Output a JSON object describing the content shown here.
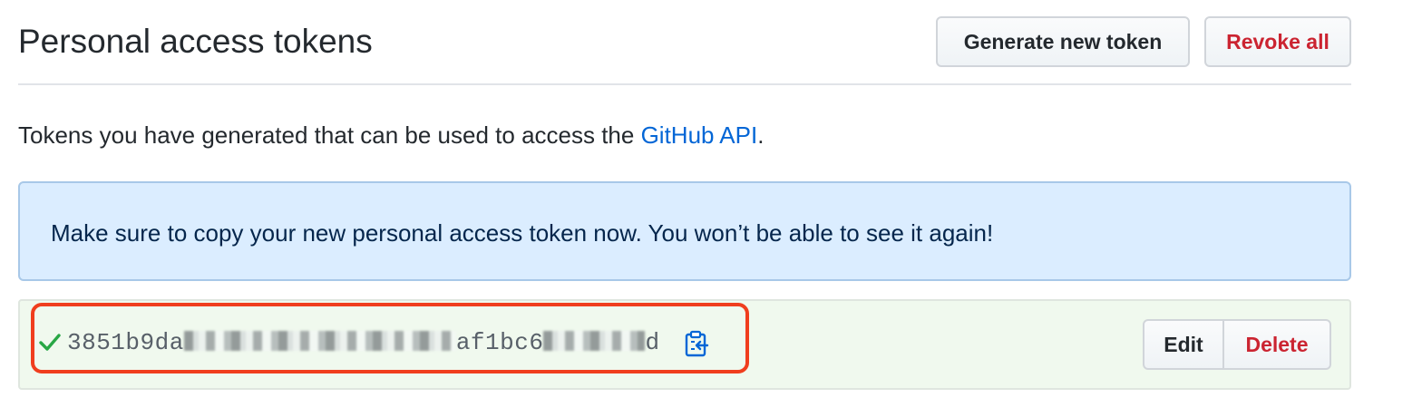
{
  "header": {
    "title": "Personal access tokens",
    "generate_label": "Generate new token",
    "revoke_label": "Revoke all"
  },
  "intro": {
    "text_before": "Tokens you have generated that can be used to access the ",
    "link_text": "GitHub API",
    "text_after": "."
  },
  "flash": {
    "message": "Make sure to copy your new personal access token now. You won’t be able to see it again!"
  },
  "token": {
    "prefix": "3851b9da",
    "middle_visible": "af1bc6",
    "suffix": "d",
    "status_icon": "check-icon",
    "copy_icon": "clipboard-copy-icon",
    "edit_label": "Edit",
    "delete_label": "Delete"
  },
  "colors": {
    "link": "#0366d6",
    "danger": "#cb2431",
    "flash_bg": "#dbedff",
    "token_bg": "#f0f9ee",
    "success": "#28a745",
    "highlight": "#f03e1e"
  }
}
